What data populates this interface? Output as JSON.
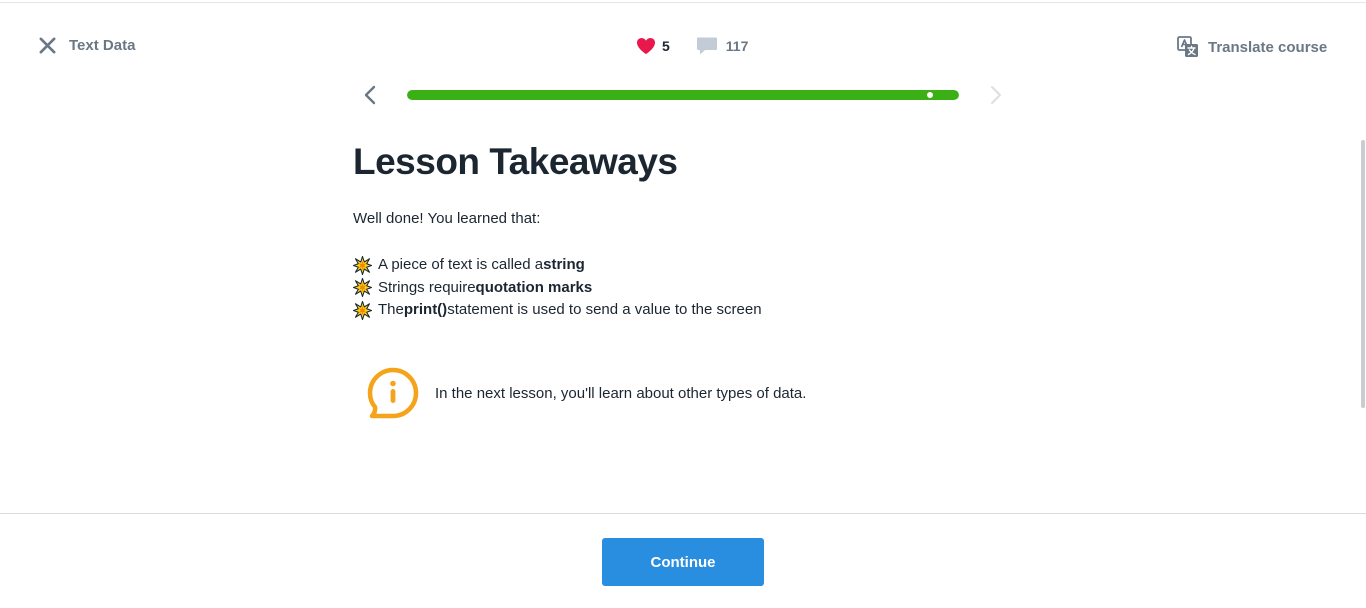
{
  "header": {
    "course_title": "Text Data",
    "hearts_count": "5",
    "comments_count": "117",
    "translate_label": "Translate course"
  },
  "progress": {
    "value_percent": 100
  },
  "lesson": {
    "title": "Lesson Takeaways",
    "intro": "Well done! You learned that:",
    "takeaways": [
      {
        "before": "A piece of text is called a ",
        "bold": "string",
        "after": ""
      },
      {
        "before": "Strings require ",
        "bold": "quotation marks",
        "after": ""
      },
      {
        "before": "The ",
        "bold": "print()",
        "after": " statement is used to send a value to the screen"
      }
    ],
    "info_text": "In the next lesson, you'll learn about other types of data."
  },
  "footer": {
    "continue_label": "Continue"
  },
  "colors": {
    "accent_blue": "#2a8ee0",
    "progress_green": "#3ab015",
    "heart_red": "#e8184c",
    "info_orange": "#f5a31a",
    "muted_gray": "#6a7886"
  },
  "icons": [
    "close-icon",
    "heart-icon",
    "comment-icon",
    "translate-icon",
    "chevron-left-icon",
    "chevron-right-icon",
    "burst-icon",
    "info-icon"
  ]
}
